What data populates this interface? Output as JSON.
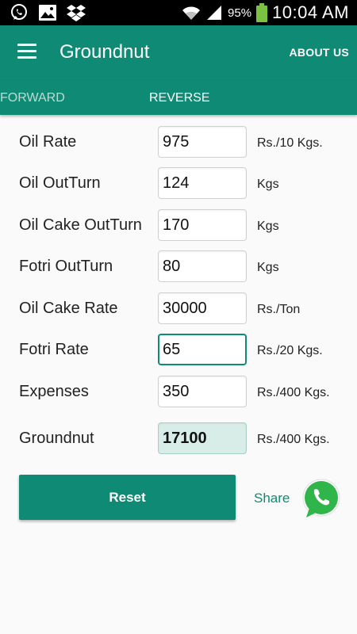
{
  "status_bar": {
    "icons": [
      "whatsapp-notification-icon",
      "gallery-icon",
      "dropbox-icon",
      "wifi-icon",
      "signal-icon",
      "battery-icon"
    ],
    "battery_percent": "95%",
    "time": "10:04 AM"
  },
  "app_bar": {
    "title": "Groundnut",
    "about_label": "ABOUT US",
    "color": "#0f8a74"
  },
  "tabs": [
    {
      "label": "FORWARD",
      "selected": false
    },
    {
      "label": "REVERSE",
      "selected": true
    }
  ],
  "rows": [
    {
      "label": "Oil Rate",
      "value": "975",
      "unit": "Rs./10 Kgs."
    },
    {
      "label": "Oil OutTurn",
      "value": "124",
      "unit": "Kgs"
    },
    {
      "label": "Oil Cake OutTurn",
      "value": "170",
      "unit": "Kgs"
    },
    {
      "label": "Fotri OutTurn",
      "value": "80",
      "unit": "Kgs"
    },
    {
      "label": "Oil Cake Rate",
      "value": "30000",
      "unit": "Rs./Ton"
    },
    {
      "label": "Fotri Rate",
      "value": "65",
      "unit": "Rs./20 Kgs."
    },
    {
      "label": "Expenses",
      "value": "350",
      "unit": "Rs./400 Kgs."
    }
  ],
  "result": {
    "label": "Groundnut",
    "value": "17100",
    "unit": "Rs./400 Kgs."
  },
  "actions": {
    "reset_label": "Reset",
    "share_label": "Share"
  }
}
